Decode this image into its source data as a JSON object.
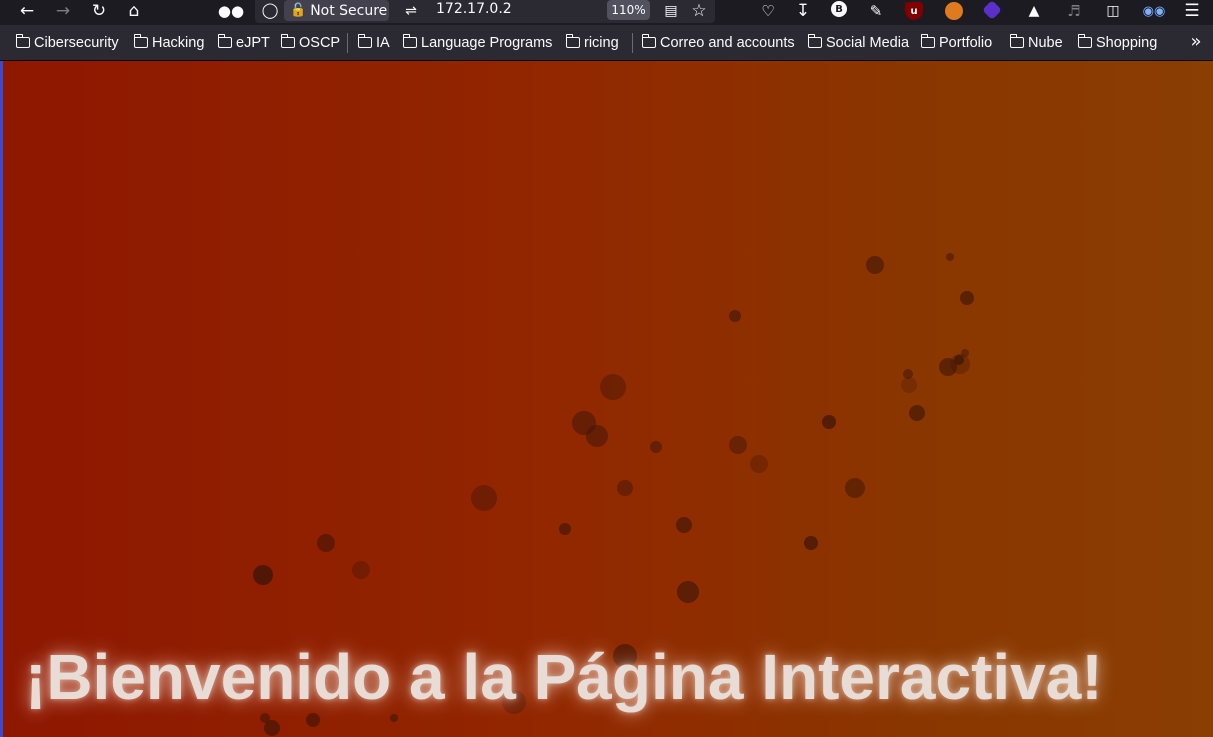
{
  "browser": {
    "security_label": "Not Secure",
    "url": "172.17.0.2",
    "zoom": "110%",
    "extensions": [
      "pocket-icon",
      "download-icon",
      "b-extension-icon",
      "puzzle-icon",
      "ublock-icon",
      "ext-orange-icon",
      "ext-purple-icon",
      "ext-sneaker-icon",
      "speaker-icon",
      "trash-icon",
      "mask-icon"
    ],
    "colors": {
      "toolbar": "#1c1b22",
      "bookmarks_bar": "#2b2a33",
      "urlbar": "#2b2a33"
    }
  },
  "bookmarks": [
    "Cibersecurity",
    "Hacking",
    "eJPT",
    "OSCP",
    "IA",
    "Language Programs",
    "ricing",
    "Correo and accounts",
    "Social Media",
    "Portfolio",
    "Nube",
    "Shopping"
  ],
  "page": {
    "headline": "¡Bienvenido a la Página Interactiva!",
    "colors": {
      "gradient_start": "#8e1700",
      "gradient_end": "#8a3e02",
      "bubble": "#3a1208"
    }
  }
}
